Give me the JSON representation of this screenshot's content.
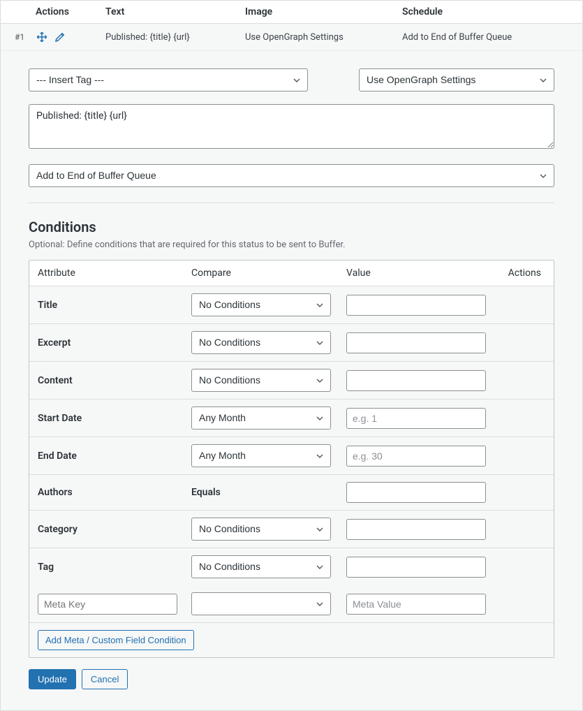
{
  "table_headers": {
    "actions": "Actions",
    "text": "Text",
    "image": "Image",
    "schedule": "Schedule"
  },
  "summary": {
    "index": "#1",
    "text": "Published: {title} {url}",
    "image": "Use OpenGraph Settings",
    "schedule": "Add to End of Buffer Queue"
  },
  "editor": {
    "insert_tag": "--- Insert Tag ---",
    "image_select": "Use OpenGraph Settings",
    "message": "Published: {title} {url}",
    "schedule_select": "Add to End of Buffer Queue"
  },
  "conditions": {
    "title": "Conditions",
    "subtitle": "Optional: Define conditions that are required for this status to be sent to Buffer.",
    "headers": {
      "attr": "Attribute",
      "compare": "Compare",
      "value": "Value",
      "actions": "Actions"
    },
    "rows": [
      {
        "attr": "Title",
        "compare": "No Conditions",
        "value": "",
        "placeholder": ""
      },
      {
        "attr": "Excerpt",
        "compare": "No Conditions",
        "value": "",
        "placeholder": ""
      },
      {
        "attr": "Content",
        "compare": "No Conditions",
        "value": "",
        "placeholder": ""
      },
      {
        "attr": "Start Date",
        "compare": "Any Month",
        "value": "",
        "placeholder": "e.g. 1"
      },
      {
        "attr": "End Date",
        "compare": "Any Month",
        "value": "",
        "placeholder": "e.g. 30"
      },
      {
        "attr": "Authors",
        "compare_static": "Equals",
        "value": "",
        "placeholder": ""
      },
      {
        "attr": "Category",
        "compare": "No Conditions",
        "value": "",
        "placeholder": ""
      },
      {
        "attr": "Tag",
        "compare": "No Conditions",
        "value": "",
        "placeholder": ""
      }
    ],
    "meta_key_placeholder": "Meta Key",
    "meta_value_placeholder": "Meta Value",
    "add_meta_label": "Add Meta / Custom Field Condition"
  },
  "footer": {
    "update": "Update",
    "cancel": "Cancel"
  }
}
